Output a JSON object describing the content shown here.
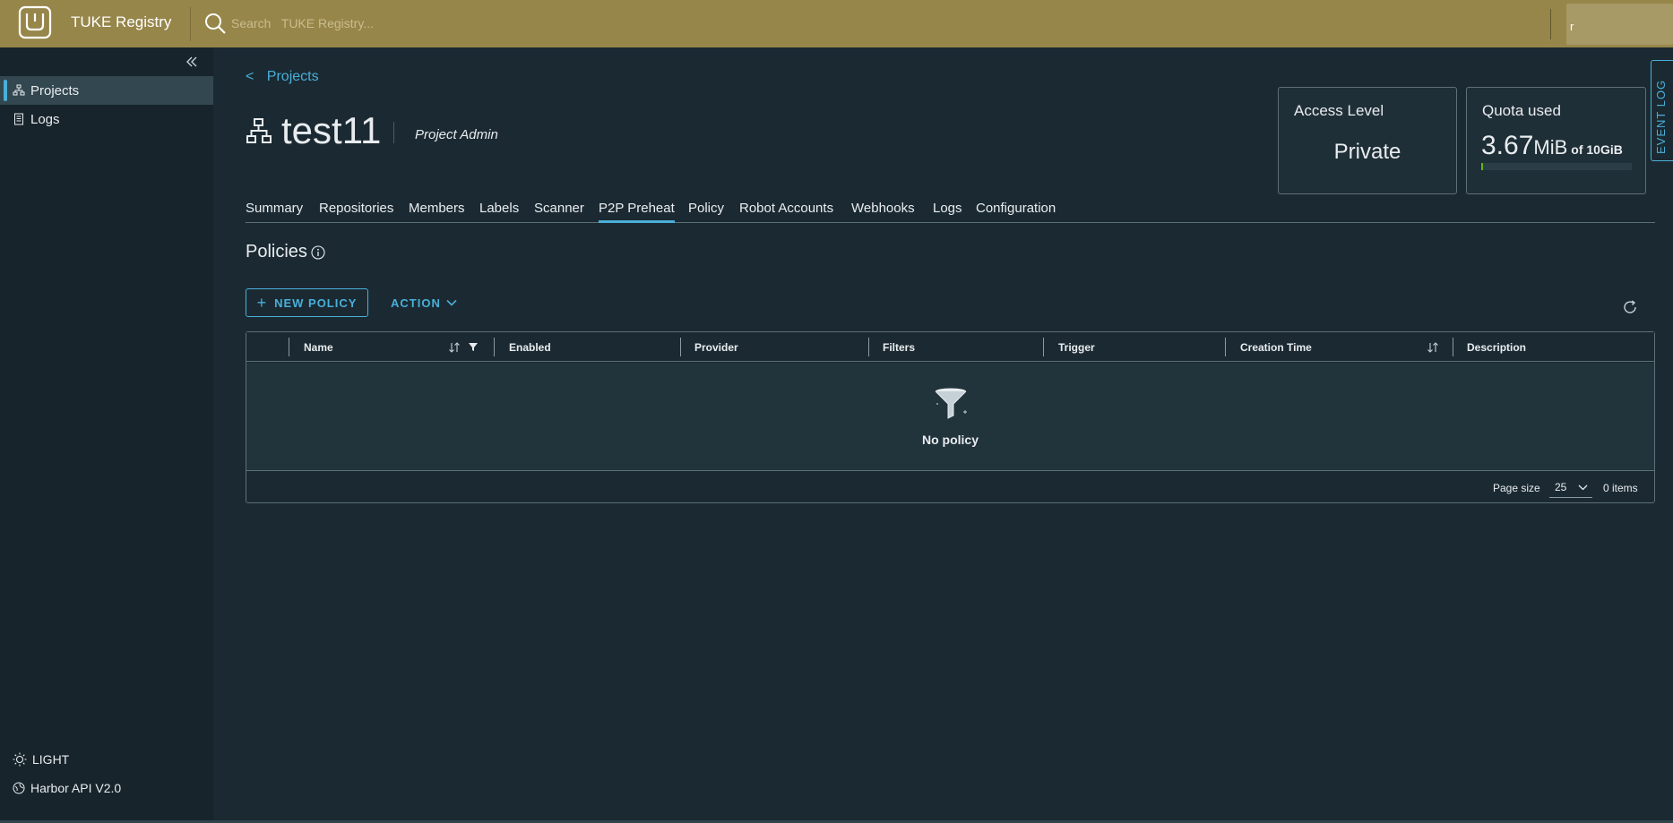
{
  "header": {
    "brand": "TUKE Registry",
    "search_placeholder": "Search   TUKE Registry...",
    "user_initial": "r",
    "background_color": "#97864a",
    "logo_icon": "harbor-logo-icon"
  },
  "sidebar": {
    "items": [
      {
        "label": "Projects",
        "icon": "projects-icon",
        "active": true
      },
      {
        "label": "Logs",
        "icon": "logs-icon",
        "active": false
      }
    ],
    "theme_toggle": "LIGHT",
    "api_link": "Harbor API V2.0"
  },
  "breadcrumb": {
    "label": "Projects"
  },
  "project": {
    "name": "test11",
    "role": "Project Admin"
  },
  "access_card": {
    "title": "Access Level",
    "value": "Private"
  },
  "quota_card": {
    "title": "Quota used",
    "used_number": "3.67",
    "used_unit": "MiB",
    "of_text": "of 10GiB",
    "used_fraction": 0.0004
  },
  "event_log": {
    "label": "EVENT LOG"
  },
  "tabs": [
    {
      "label": "Summary"
    },
    {
      "label": "Repositories"
    },
    {
      "label": "Members"
    },
    {
      "label": "Labels"
    },
    {
      "label": "Scanner"
    },
    {
      "label": "P2P Preheat",
      "active": true
    },
    {
      "label": "Policy"
    },
    {
      "label": "Robot Accounts"
    },
    {
      "label": "Webhooks"
    },
    {
      "label": "Logs"
    },
    {
      "label": "Configuration"
    }
  ],
  "policies": {
    "title": "Policies",
    "new_policy_label": "NEW POLICY",
    "action_label": "ACTION"
  },
  "table": {
    "columns": [
      {
        "label": "Name"
      },
      {
        "label": "Enabled"
      },
      {
        "label": "Provider"
      },
      {
        "label": "Filters"
      },
      {
        "label": "Trigger"
      },
      {
        "label": "Creation Time"
      },
      {
        "label": "Description"
      }
    ],
    "empty_text": "No policy",
    "page_size_label": "Page size",
    "page_size_value": "25",
    "items_count": "0 items"
  },
  "colors": {
    "accent": "#49afd9",
    "background": "#1b2a32",
    "sidebar": "#17242b",
    "quota_fill": "#60b515"
  }
}
